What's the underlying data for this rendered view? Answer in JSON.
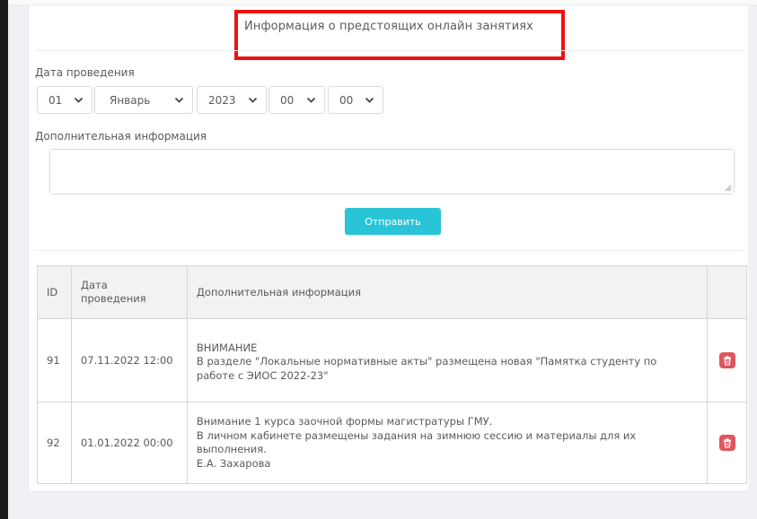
{
  "form": {
    "title": "Информация о предстоящих онлайн занятиях",
    "date_label": "Дата проведения",
    "day": "01",
    "month": "Январь",
    "year": "2023",
    "hour": "00",
    "minute": "00",
    "info_label": "Дополнительная информация",
    "info_value": "",
    "submit_label": "Отправить"
  },
  "table": {
    "headers": {
      "id": "ID",
      "date": "Дата проведения",
      "info": "Дополнительная информация"
    },
    "rows": [
      {
        "id": "91",
        "date": "07.11.2022 12:00",
        "lines": [
          "ВНИМАНИЕ",
          "В разделе \"Локальные нормативные акты\" размещена новая \"Памятка студенту по работе с ЭИОС 2022-23\""
        ]
      },
      {
        "id": "92",
        "date": "01.01.2022 00:00",
        "lines": [
          "Внимание 1 курса заочной формы магистратуры ГМУ.",
          "В личном кабинете размещены задания на зимнюю сессию и материалы для их выполнения.",
          "Е.А. Захарова"
        ]
      }
    ]
  },
  "colors": {
    "accent": "#2ac4d8",
    "danger": "#e0565f",
    "highlight": "#ee1010"
  },
  "icons": {
    "select_arrow": "chevron-down-icon",
    "row_action": "trash-icon"
  }
}
